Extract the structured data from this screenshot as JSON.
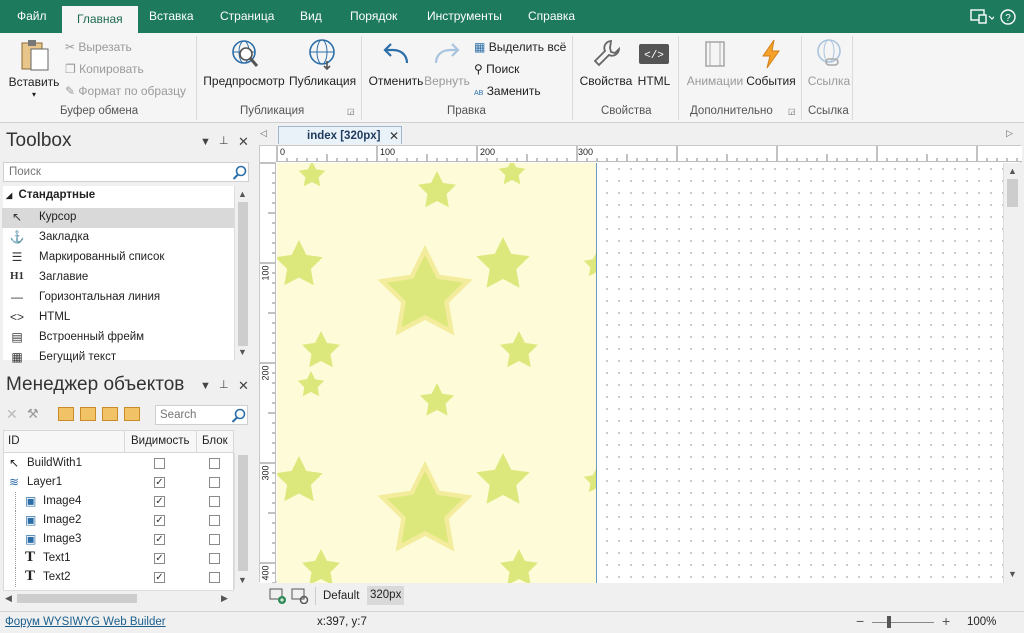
{
  "menu": {
    "tabs": [
      "Файл",
      "Главная",
      "Вставка",
      "Страница",
      "Вид",
      "Порядок",
      "Инструменты",
      "Справка"
    ],
    "active": "Главная"
  },
  "ribbon": {
    "clipboard": {
      "paste": "Вставить",
      "cut": "Вырезать",
      "copy": "Копировать",
      "format": "Формат по образцу",
      "group": "Буфер обмена"
    },
    "publish": {
      "preview": "Предпросмотр",
      "publish": "Публикация",
      "group": "Публикация"
    },
    "edit": {
      "undo": "Отменить",
      "redo": "Вернуть",
      "select_all": "Выделить всё",
      "find": "Поиск",
      "replace": "Заменить",
      "group": "Правка"
    },
    "props": {
      "properties": "Свойства",
      "html": "HTML",
      "group": "Свойства"
    },
    "extra": {
      "animations": "Анимации",
      "events": "События",
      "group": "Дополнительно"
    },
    "link": {
      "link": "Ссылка",
      "group": "Ссылка"
    }
  },
  "toolbox": {
    "title": "Toolbox",
    "search_placeholder": "Поиск",
    "category": "Стандартные",
    "items": [
      {
        "label": "Курсор",
        "icon": "cursor-icon"
      },
      {
        "label": "Закладка",
        "icon": "anchor-icon"
      },
      {
        "label": "Маркированный список",
        "icon": "list-icon"
      },
      {
        "label": "Заглавие",
        "icon": "heading-icon"
      },
      {
        "label": "Горизонтальная линия",
        "icon": "hline-icon"
      },
      {
        "label": "HTML",
        "icon": "html-icon"
      },
      {
        "label": "Встроенный фрейм",
        "icon": "iframe-icon"
      },
      {
        "label": "Бегущий текст",
        "icon": "marquee-icon"
      }
    ]
  },
  "object_manager": {
    "title": "Менеджер объектов",
    "search_placeholder": "Search",
    "columns": [
      "ID",
      "Видимость",
      "Блок"
    ],
    "rows": [
      {
        "id": "BuildWith1",
        "visible": false,
        "lock": false,
        "indent": 0,
        "icon": "cursor-icon"
      },
      {
        "id": "Layer1",
        "visible": true,
        "lock": false,
        "indent": 0,
        "icon": "layer-icon"
      },
      {
        "id": "Image4",
        "visible": true,
        "lock": false,
        "indent": 1,
        "icon": "image-icon"
      },
      {
        "id": "Image2",
        "visible": true,
        "lock": false,
        "indent": 1,
        "icon": "image-icon"
      },
      {
        "id": "Image3",
        "visible": true,
        "lock": false,
        "indent": 1,
        "icon": "image-icon"
      },
      {
        "id": "Text1",
        "visible": true,
        "lock": false,
        "indent": 1,
        "icon": "text-icon"
      },
      {
        "id": "Text2",
        "visible": true,
        "lock": false,
        "indent": 1,
        "icon": "text-icon"
      }
    ]
  },
  "document_tab": "index [320px]",
  "ruler": {
    "h": [
      "0",
      "100",
      "200",
      "300"
    ],
    "v": [
      "100",
      "200",
      "300",
      "400"
    ]
  },
  "canvas_footer": {
    "default": "Default",
    "breakpoint": "320px"
  },
  "status": {
    "forum_link": "Форум WYSIWYG Web Builder",
    "coords": "x:397, y:7",
    "zoom": "100%"
  },
  "colors": {
    "accent": "#1e7a5c",
    "star": "#dde87c",
    "star_glow": "#f3ec9c",
    "page_bg": "#fdfbd8"
  }
}
